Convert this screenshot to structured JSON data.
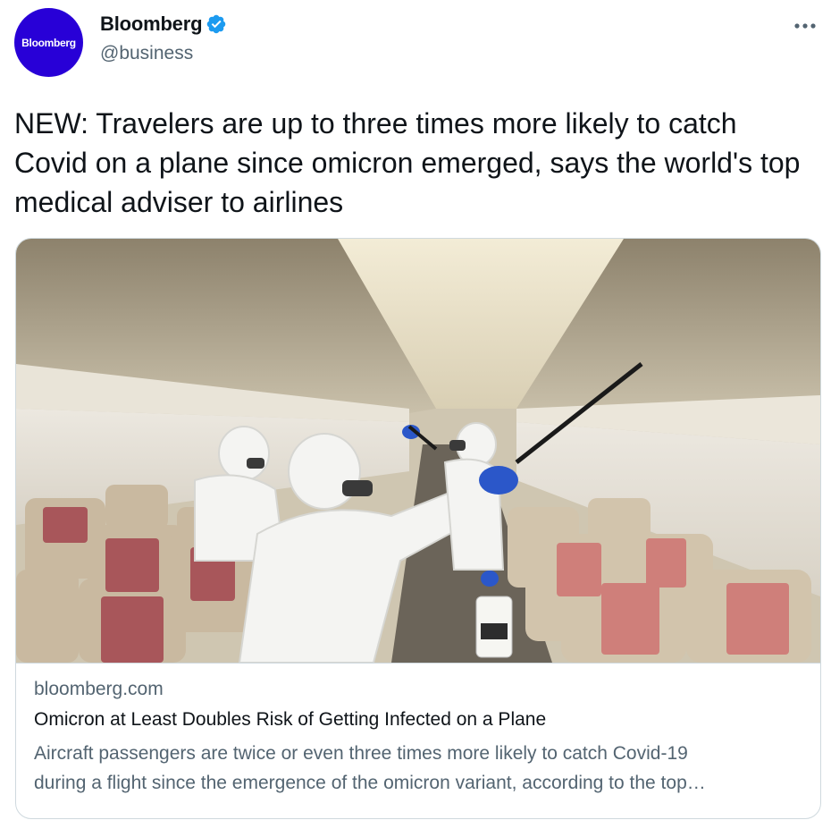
{
  "author": {
    "avatar_text": "Bloomberg",
    "name": "Bloomberg",
    "handle": "@business",
    "verified": true,
    "avatar_color": "#2800d7"
  },
  "more_icon": "more-horizontal-icon",
  "tweet": {
    "text": "NEW: Travelers are up to three times more likely to catch Covid on a plane since omicron emerged, says the world's top medical adviser to airlines"
  },
  "card": {
    "image_description": "Workers in white protective suits disinfecting an airplane cabin",
    "domain": "bloomberg.com",
    "title": "Omicron at Least Doubles Risk of Getting Infected on a Plane",
    "description_line1": "Aircraft passengers are twice or even three times more likely to catch Covid-19",
    "description_line2": "during a flight since the emergence of the omicron variant, according to the top…"
  },
  "colors": {
    "verified_blue": "#1d9bf0",
    "secondary_text": "#536471",
    "border": "#cfd9de"
  }
}
